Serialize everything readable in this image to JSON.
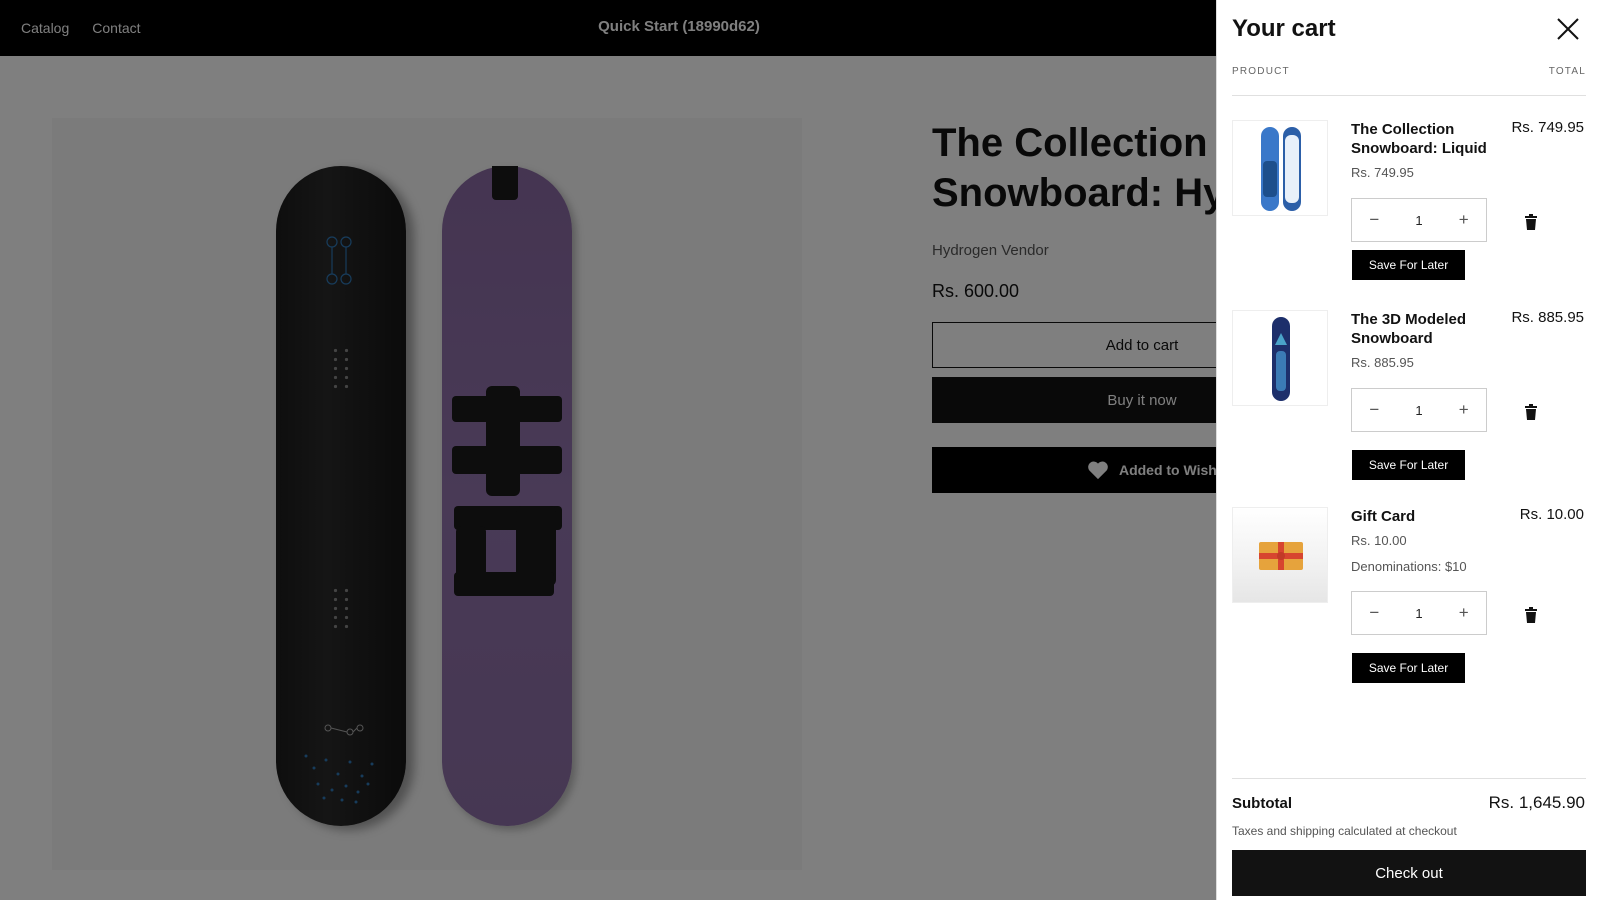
{
  "header": {
    "nav": [
      "Catalog",
      "Contact"
    ],
    "site_title": "Quick Start (18990d62)"
  },
  "product": {
    "title": "The Collection\nSnowboard: Hy",
    "vendor": "Hydrogen Vendor",
    "price": "Rs. 600.00",
    "add_to_cart": "Add to cart",
    "buy_now": "Buy it now",
    "wishlist": "Added to Wishlist"
  },
  "cart": {
    "title": "Your cart",
    "col_product": "PRODUCT",
    "col_total": "TOTAL",
    "items": [
      {
        "name": "The Collection Snowboard: Liquid",
        "price": "Rs. 749.95",
        "total": "Rs. 749.95",
        "quantity": "1",
        "variant": "",
        "save_label": "Save For Later"
      },
      {
        "name": "The 3D Modeled Snowboard",
        "price": "Rs. 885.95",
        "total": "Rs. 885.95",
        "quantity": "1",
        "variant": "",
        "save_label": "Save For Later"
      },
      {
        "name": "Gift Card",
        "price": "Rs. 10.00",
        "total": "Rs. 10.00",
        "quantity": "1",
        "variant": "Denominations: $10",
        "save_label": "Save For Later"
      }
    ],
    "subtotal_label": "Subtotal",
    "subtotal_value": "Rs. 1,645.90",
    "tax_note": "Taxes and shipping calculated at checkout",
    "checkout_label": "Check out"
  },
  "colors": {
    "header_bg": "#000000",
    "overlay": "rgba(0,0,0,0.5)",
    "board_purple": "#8d6fa6"
  }
}
